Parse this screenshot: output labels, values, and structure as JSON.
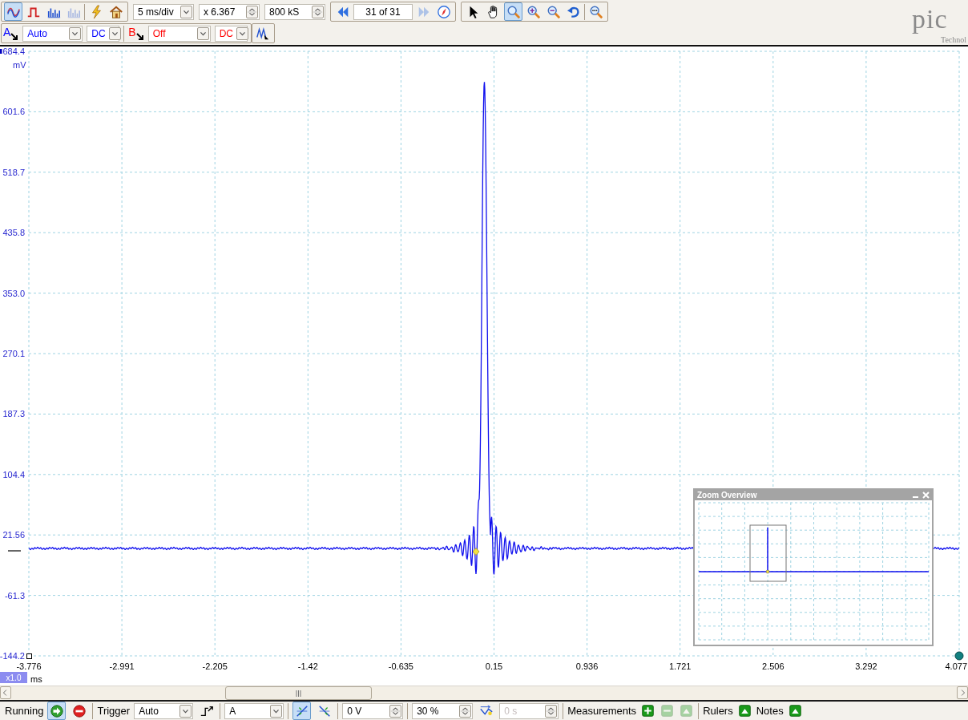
{
  "top_toolbar": {
    "view_modes": [
      {
        "kind": "scope",
        "selected": true,
        "disabled": false
      },
      {
        "kind": "persistence",
        "selected": false,
        "disabled": false
      },
      {
        "kind": "spectrum",
        "selected": false,
        "disabled": false
      },
      {
        "kind": "spectrum",
        "selected": false,
        "disabled": true
      }
    ],
    "setup_buttons": [
      {
        "kind": "lightning"
      },
      {
        "kind": "home"
      }
    ],
    "timebase": "5 ms/div",
    "zoom_factor": "x 6.367",
    "samples": "800 kS",
    "buffer": {
      "value": "31 of 31",
      "previous_disabled": false,
      "next_disabled": true
    },
    "tools": [
      {
        "kind": "pointer",
        "selected": false
      },
      {
        "kind": "hand",
        "selected": false
      },
      {
        "kind": "zoom",
        "selected": true
      },
      {
        "kind": "zoom-in",
        "selected": false
      },
      {
        "kind": "zoom-out",
        "selected": false
      },
      {
        "kind": "undo",
        "selected": false
      },
      {
        "kind": "zoom-fit",
        "selected": false
      }
    ],
    "logo": {
      "text": "pic",
      "subtitle": "Technol"
    }
  },
  "channel_bar": {
    "channels": [
      {
        "label": "A",
        "color": "#0000ff",
        "range": "Auto",
        "coupling": "DC",
        "coupling_disabled": false
      },
      {
        "label": "B",
        "color": "#ff0000",
        "range": "Off",
        "coupling": "DC",
        "coupling_disabled": true
      }
    ]
  },
  "plot": {
    "y_unit": "mV",
    "y_ticks": [
      "684.4",
      "601.6",
      "518.7",
      "435.8",
      "353.0",
      "270.1",
      "187.3",
      "104.4",
      "21.56",
      "-61.3",
      "-144.2"
    ],
    "x_ticks": [
      "-3.776",
      "-2.991",
      "-2.205",
      "-1.42",
      "-0.635",
      "0.15",
      "0.936",
      "1.721",
      "2.506",
      "3.292",
      "4.077"
    ],
    "x_scale": "x1.0",
    "x_unit": "ms",
    "zoom_overview": {
      "title": "Zoom Overview"
    }
  },
  "bottom_bar": {
    "status": "Running",
    "run_selected": true,
    "trigger_label": "Trigger",
    "trigger_mode": "Auto",
    "trigger_source": "A",
    "edges": [
      {
        "kind": "rising",
        "selected": true
      },
      {
        "kind": "falling",
        "selected": false
      }
    ],
    "threshold": "0 V",
    "pre_trigger": "30 %",
    "delay": {
      "value": "0 s",
      "disabled": true
    },
    "measurements": {
      "label": "Measurements",
      "buttons": [
        {
          "kind": "add",
          "disabled": false
        },
        {
          "kind": "remove",
          "disabled": true
        },
        {
          "kind": "edit",
          "disabled": true
        }
      ]
    },
    "rulers": {
      "label": "Rulers"
    },
    "notes": {
      "label": "Notes"
    }
  }
}
